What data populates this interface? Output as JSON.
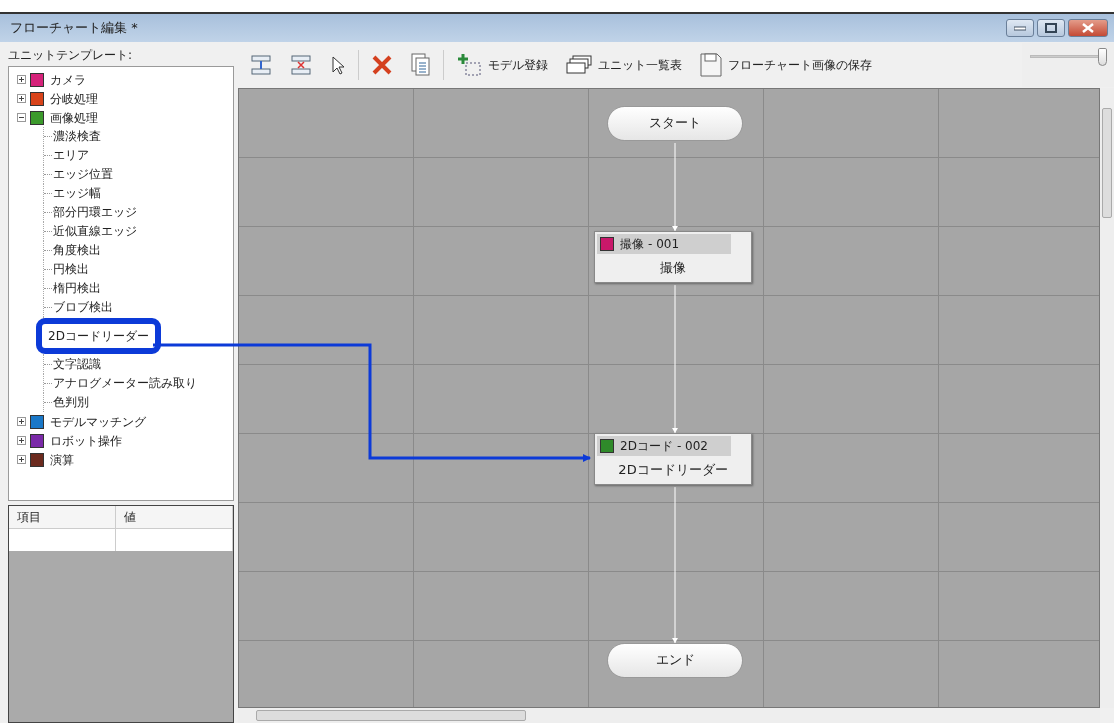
{
  "window": {
    "title": "フローチャート編集 *"
  },
  "template_panel": {
    "label": "ユニットテンプレート:",
    "tree": [
      {
        "label": "カメラ",
        "color": "#d6227a",
        "expanded": false
      },
      {
        "label": "分岐処理",
        "color": "#d8431a",
        "expanded": false
      },
      {
        "label": "画像処理",
        "color": "#3c9a2c",
        "expanded": true,
        "children": [
          {
            "label": "濃淡検査",
            "highlighted": false
          },
          {
            "label": "エリア",
            "highlighted": false
          },
          {
            "label": "エッジ位置",
            "highlighted": false
          },
          {
            "label": "エッジ幅",
            "highlighted": false
          },
          {
            "label": "部分円環エッジ",
            "highlighted": false
          },
          {
            "label": "近似直線エッジ",
            "highlighted": false
          },
          {
            "label": "角度検出",
            "highlighted": false
          },
          {
            "label": "円検出",
            "highlighted": false
          },
          {
            "label": "楕円検出",
            "highlighted": false
          },
          {
            "label": "ブロブ検出",
            "highlighted": false
          },
          {
            "label": "2Dコードリーダー",
            "highlighted": true
          },
          {
            "label": "文字認識",
            "highlighted": false
          },
          {
            "label": "アナログメーター読み取り",
            "highlighted": false
          },
          {
            "label": "色判別",
            "highlighted": false
          }
        ]
      },
      {
        "label": "モデルマッチング",
        "color": "#1a78c8",
        "expanded": false
      },
      {
        "label": "ロボット操作",
        "color": "#7a2aa8",
        "expanded": false
      },
      {
        "label": "演算",
        "color": "#6b2a1e",
        "expanded": false
      }
    ]
  },
  "properties": {
    "columns": [
      "項目",
      "値"
    ]
  },
  "toolbar": {
    "labels": [
      "モデル登録",
      "ユニット一覧表",
      "フローチャート画像の保存"
    ],
    "zoom": {
      "level": 0.97
    }
  },
  "flowchart": {
    "nodes": [
      {
        "kind": "terminal",
        "label": "スタート"
      },
      {
        "kind": "unit",
        "name": "撮像",
        "number": "- 001",
        "label": "撮像",
        "color": "#c8186a"
      },
      {
        "kind": "unit",
        "name": "2Dコード",
        "number": "- 002",
        "label": "2Dコードリーダー",
        "color": "#2f8a2a"
      },
      {
        "kind": "terminal",
        "label": "エンド"
      }
    ]
  }
}
